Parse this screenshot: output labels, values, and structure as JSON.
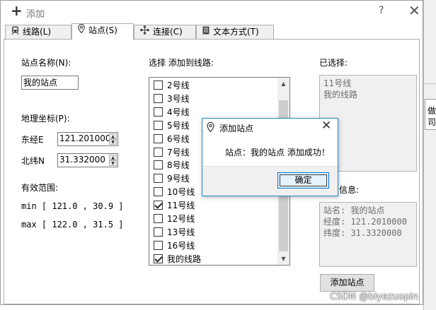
{
  "window": {
    "title": "添加",
    "help_glyph": "?",
    "close_glyph": "✕"
  },
  "tabs": [
    {
      "label": "线路(L)",
      "icon": "train-icon",
      "active": false
    },
    {
      "label": "站点(S)",
      "icon": "location-pin-icon",
      "active": true
    },
    {
      "label": "连接(C)",
      "icon": "network-icon",
      "active": false
    },
    {
      "label": "文本方式(T)",
      "icon": "document-icon",
      "active": false
    }
  ],
  "station": {
    "name_label": "站点名称(N):",
    "name_value": "我的站点",
    "coord_label": "地理坐标(P):",
    "lon_label": "东经E",
    "lon_value": "121.201000",
    "lat_label": "北纬N",
    "lat_value": "31.332000",
    "range_label": "有效范围:",
    "range_min": "min [ 121.0 , 30.9 ]",
    "range_max": "max [ 122.0 , 31.5 ]"
  },
  "lines": {
    "label": "选择 添加到线路:",
    "items": [
      {
        "label": "2号线",
        "checked": false
      },
      {
        "label": "3号线",
        "checked": false
      },
      {
        "label": "4号线",
        "checked": false
      },
      {
        "label": "5号线",
        "checked": false
      },
      {
        "label": "6号线",
        "checked": false
      },
      {
        "label": "7号线",
        "checked": false
      },
      {
        "label": "8号线",
        "checked": false
      },
      {
        "label": "9号线",
        "checked": false
      },
      {
        "label": "10号线",
        "checked": false
      },
      {
        "label": "11号线",
        "checked": true
      },
      {
        "label": "12号线",
        "checked": false
      },
      {
        "label": "13号线",
        "checked": false
      },
      {
        "label": "16号线",
        "checked": false
      },
      {
        "label": "我的线路",
        "checked": true
      }
    ]
  },
  "selected": {
    "label": "已选择:",
    "items": [
      "11号线",
      "我的线路"
    ]
  },
  "info": {
    "label_suffix": "信息:",
    "lines": [
      "站名: 我的站点",
      "经度: 121.2010000",
      "纬度: 31.3320000"
    ]
  },
  "add_button": "添加站点",
  "dialog": {
    "title": "添加站点",
    "message": "站点：我的站点 添加成功！",
    "ok": "确定"
  },
  "background_window": {
    "glyph_1": "做",
    "glyph_2": "司"
  },
  "watermark": "CSDN @biyezuopin"
}
